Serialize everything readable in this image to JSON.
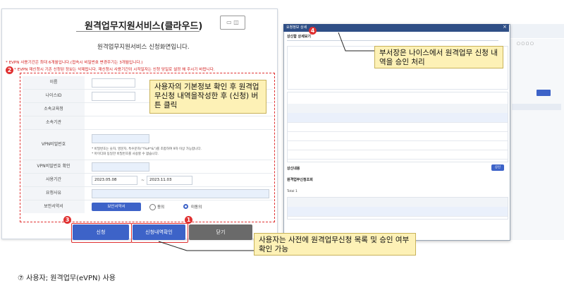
{
  "form": {
    "title": "원격업무지원서비스(클라우드)",
    "subtitle": "원격업무지원서비스 신청화면입니다.",
    "notices": [
      "* EVPN 사용기간은 최대 6개월입니다.(접속시 비밀번호 변경주기는 3개월입니다.)",
      "* EVPN 재신청시 기존 신청된 정보는 삭제됩니다. 재신청시 사용기간이 시작일자는 신청 당일로 설정 해 주시기 바랍니다."
    ],
    "fields": {
      "name": "이름",
      "neis_id": "나이스ID",
      "school_office": "소속교육청",
      "agency": "소속기관",
      "vpn_password": "VPN비밀번호",
      "vpn_password_hint1": "* 비밀번호는 숫자, 영문자, 특수문자(\"!%#*&\")를 조합하여 9자 이상 가능합니다.",
      "vpn_password_hint2": "* 아이디와 동일한 비밀번호를 사용할 수 없습니다.",
      "vpn_password_confirm": "VPN비밀번호 확인",
      "period": "사용기간",
      "period_start": "2023.05.08",
      "period_sep": "~",
      "period_end": "2023.11.03",
      "reason": "요청사유",
      "security_pledge": "보안서약서",
      "security_button": "보안서약서",
      "agree": "동의",
      "disagree": "미동의"
    },
    "buttons": {
      "apply": "신청",
      "history": "신청내역확인",
      "close": "닫기"
    }
  },
  "badges": {
    "one": "1",
    "two": "2",
    "three": "3",
    "four": "4"
  },
  "callouts": {
    "user_info": "사용자의 기본정보 확인 후 원격업무신청 내역을작성한 후 (신청) 버튼 클릭",
    "approval": "부서장은 나이스에서 원격업무 신청 내역을 승인 처리",
    "history": "사용자는 사전에 원격업무신청 목록 및 승인 여부 확인 가능"
  },
  "approval_window": {
    "title": "요청정보 상세",
    "section": "상신함 상세보기",
    "section2": "상신내용",
    "section3": "원격업무신청조회",
    "approve_button": "상신",
    "total": "Total 1"
  },
  "footer": "⑦ 사용자; 원격업무(eVPN) 사용",
  "colors": {
    "red": "#e03131",
    "blue_button": "#3d63c8",
    "gray_button": "#6a6a6a",
    "callout_bg": "#fdf1b6"
  }
}
